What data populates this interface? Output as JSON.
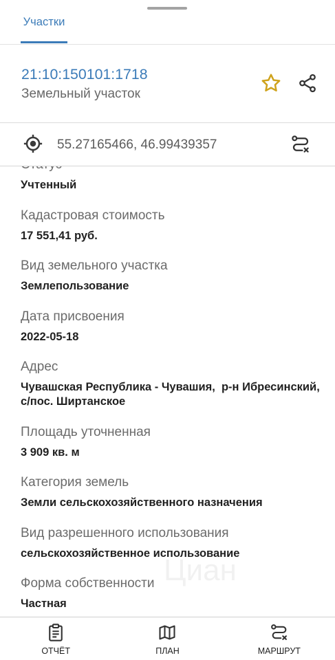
{
  "tabs": [
    {
      "label": "Участки",
      "active": true
    }
  ],
  "parcel": {
    "cadastral_number": "21:10:150101:1718",
    "type": "Земельный участок",
    "favorite_icon": "star-outline-icon",
    "share_icon": "share-icon"
  },
  "location": {
    "coordinates": "55.27165466, 46.99439357",
    "locate_icon": "gps-fixed-icon",
    "route_icon": "route-icon"
  },
  "fields": [
    {
      "label": "Статус",
      "value": "Учтенный"
    },
    {
      "label": "Кадастровая стоимость",
      "value": "17 551,41 руб."
    },
    {
      "label": "Вид земельного участка",
      "value": "Землепользование"
    },
    {
      "label": "Дата присвоения",
      "value": "2022-05-18"
    },
    {
      "label": "Адрес",
      "value": "Чувашская Республика - Чувашия,  р-н Ибресинский, с/пос. Ширтанское"
    },
    {
      "label": "Площадь уточненная",
      "value": "3 909 кв. м"
    },
    {
      "label": "Категория земель",
      "value": "Земли сельскохозяйственного назначения"
    },
    {
      "label": "Вид разрешенного использования",
      "value": "сельскохозяйственное использование"
    },
    {
      "label": "Форма собственности",
      "value": "Частная"
    }
  ],
  "bottom_nav": [
    {
      "label": "ОТЧЁТ",
      "icon": "report-icon"
    },
    {
      "label": "ПЛАН",
      "icon": "map-icon"
    },
    {
      "label": "МАРШРУТ",
      "icon": "route-icon"
    }
  ],
  "watermark": "Циан",
  "colors": {
    "accent": "#3b7bb8",
    "star": "#cfa31d",
    "label": "#6b6b6b",
    "value": "#212121"
  }
}
